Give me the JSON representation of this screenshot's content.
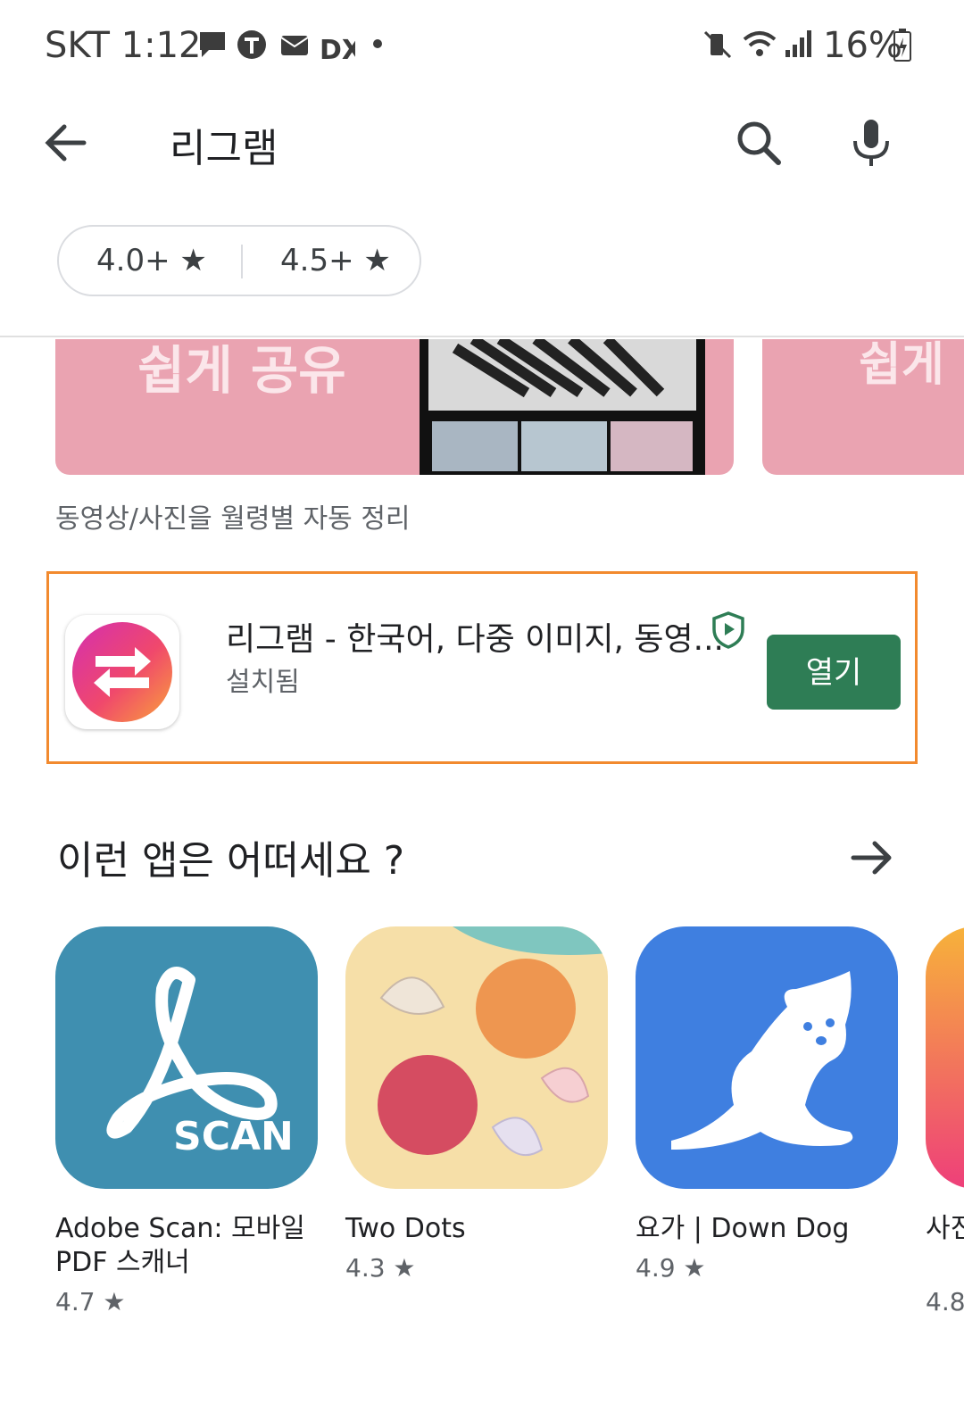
{
  "status_bar": {
    "carrier_time": "SKT 1:12",
    "battery": "16%"
  },
  "search": {
    "query": "리그램"
  },
  "filters": [
    {
      "label": "4.0+ ★"
    },
    {
      "label": "4.5+ ★"
    }
  ],
  "banner": {
    "text1": "쉽게 공유",
    "text2": "쉽게",
    "caption": "동영상/사진을 월령별 자동 정리"
  },
  "app": {
    "title": "리그램 - 한국어, 다중 이미지, 동영...",
    "status": "설치됨",
    "open_label": "열기"
  },
  "section": {
    "title": "이런 앱은 어떠세요 ?",
    "apps": [
      {
        "name": "Adobe Scan: 모바일 PDF 스캐너",
        "rating": "4.7 ★",
        "icon_text": "SCAN"
      },
      {
        "name": "Two Dots",
        "rating": "4.3 ★"
      },
      {
        "name": "요가 | Down Dog",
        "rating": "4.9 ★"
      },
      {
        "name": "사진 Ed",
        "rating": "4.8"
      }
    ]
  }
}
